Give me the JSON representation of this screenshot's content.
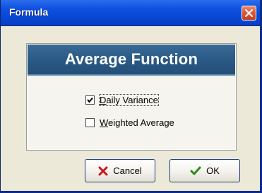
{
  "window": {
    "title": "Formula",
    "close_icon": "close-icon"
  },
  "panel": {
    "title": "Average Function"
  },
  "options": [
    {
      "label": "Daily Variance",
      "checked": true,
      "accesskey": "D"
    },
    {
      "label": "Weighted Average",
      "checked": false,
      "accesskey": "W"
    }
  ],
  "buttons": {
    "cancel": {
      "label": "Cancel",
      "icon": "x-icon"
    },
    "ok": {
      "label": "OK",
      "icon": "checkmark-icon"
    }
  },
  "colors": {
    "titlebar": "#0748d6",
    "panel_header": "#2a5a86",
    "close_button": "#d85a3a",
    "cancel_icon": "#c8161d",
    "ok_icon": "#2e8b1a"
  }
}
